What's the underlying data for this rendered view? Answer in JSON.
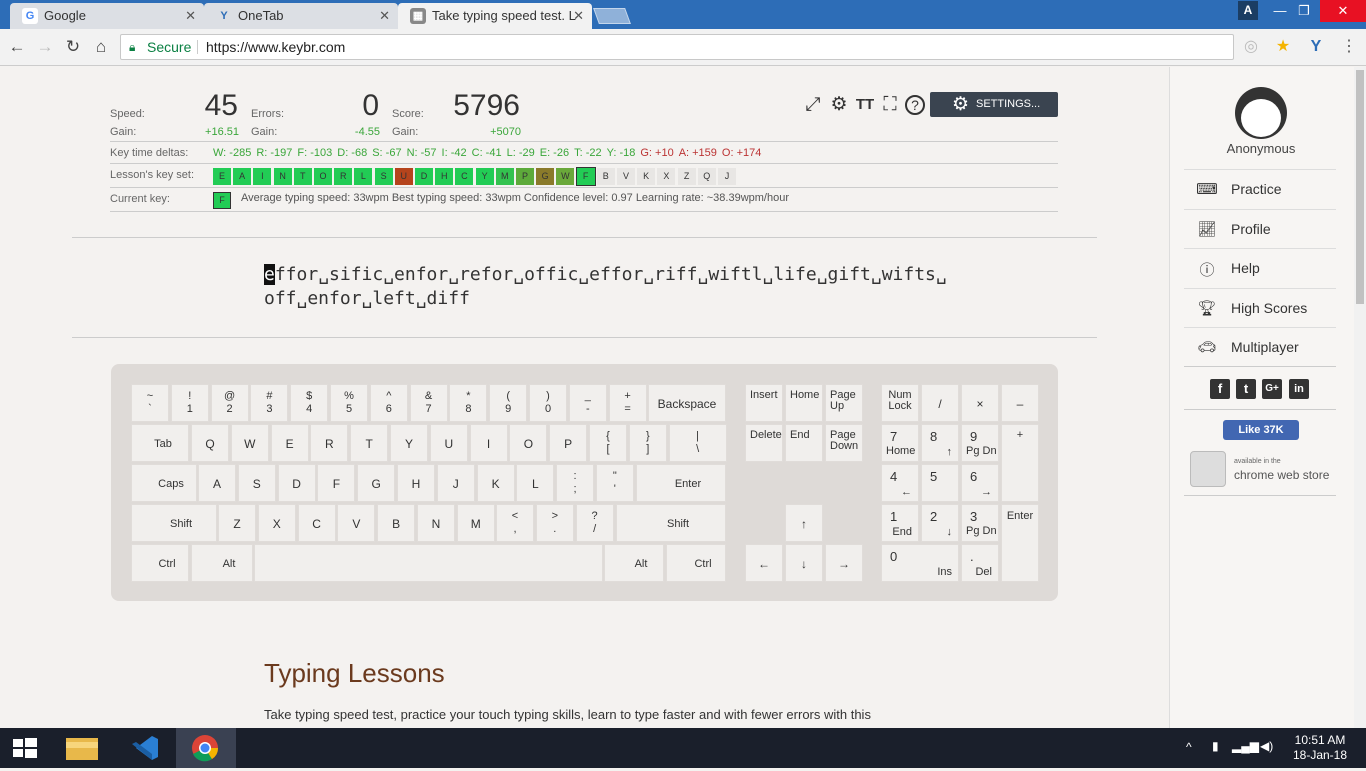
{
  "browser": {
    "tabs": [
      {
        "title": "Google",
        "icon": "google-icon",
        "active": false
      },
      {
        "title": "OneTab",
        "icon": "onetab-icon",
        "active": false
      },
      {
        "title": "Take typing speed test. L",
        "icon": "keybr-icon",
        "active": true
      }
    ],
    "profile_initial": "A",
    "secure_label": "Secure",
    "url": "https://www.keybr.com"
  },
  "stats": {
    "speed_label": "Speed:",
    "speed_value": "45",
    "speed_gain_label": "Gain:",
    "speed_gain": "+16.51",
    "errors_label": "Errors:",
    "errors_value": "0",
    "errors_gain_label": "Gain:",
    "errors_gain": "-4.55",
    "score_label": "Score:",
    "score_value": "5796",
    "score_gain_label": "Gain:",
    "score_gain": "+5070"
  },
  "key_deltas_label": "Key time deltas:",
  "key_deltas": [
    {
      "text": "W: -285",
      "sign": "pos"
    },
    {
      "text": "R: -197",
      "sign": "pos"
    },
    {
      "text": "F: -103",
      "sign": "pos"
    },
    {
      "text": "D: -68",
      "sign": "pos"
    },
    {
      "text": "S: -67",
      "sign": "pos"
    },
    {
      "text": "N: -57",
      "sign": "pos"
    },
    {
      "text": "I: -42",
      "sign": "pos"
    },
    {
      "text": "C: -41",
      "sign": "pos"
    },
    {
      "text": "L: -29",
      "sign": "pos"
    },
    {
      "text": "E: -26",
      "sign": "pos"
    },
    {
      "text": "T: -22",
      "sign": "pos"
    },
    {
      "text": "Y: -18",
      "sign": "pos"
    },
    {
      "text": "G: +10",
      "sign": "neg"
    },
    {
      "text": "A: +159",
      "sign": "neg"
    },
    {
      "text": "O: +174",
      "sign": "neg"
    }
  ],
  "keyset_label": "Lesson's key set:",
  "keyset": [
    {
      "k": "E",
      "c": "#22cc55"
    },
    {
      "k": "A",
      "c": "#22cc55"
    },
    {
      "k": "I",
      "c": "#22cc55"
    },
    {
      "k": "N",
      "c": "#22cc55"
    },
    {
      "k": "T",
      "c": "#22cc55"
    },
    {
      "k": "O",
      "c": "#22cc55"
    },
    {
      "k": "R",
      "c": "#22cc55"
    },
    {
      "k": "L",
      "c": "#22cc55"
    },
    {
      "k": "S",
      "c": "#22cc55"
    },
    {
      "k": "U",
      "c": "#b5441c"
    },
    {
      "k": "D",
      "c": "#22cc55"
    },
    {
      "k": "H",
      "c": "#22cc55"
    },
    {
      "k": "C",
      "c": "#22cc55"
    },
    {
      "k": "Y",
      "c": "#22cc55"
    },
    {
      "k": "M",
      "c": "#33c24f"
    },
    {
      "k": "P",
      "c": "#5daa3a"
    },
    {
      "k": "G",
      "c": "#8a7a2a"
    },
    {
      "k": "W",
      "c": "#6aa83a"
    },
    {
      "k": "F",
      "c": "#22cc55"
    },
    {
      "k": "B",
      "c": "#e8e6e4"
    },
    {
      "k": "V",
      "c": "#e8e6e4"
    },
    {
      "k": "K",
      "c": "#e8e6e4"
    },
    {
      "k": "X",
      "c": "#e8e6e4"
    },
    {
      "k": "Z",
      "c": "#e8e6e4"
    },
    {
      "k": "Q",
      "c": "#e8e6e4"
    },
    {
      "k": "J",
      "c": "#e8e6e4"
    }
  ],
  "current_key_label": "Current key:",
  "current_key": "F",
  "current_info": "Average typing speed: 33wpm   Best typing speed: 33wpm   Confidence level: 0.97   Learning rate: ~38.39wpm/hour",
  "settings_label": "SETTINGS...",
  "practice_cursor": "e",
  "practice_rest": "ffor␣sific␣enfor␣refor␣offic␣effor␣riff␣wiftl␣life␣gift␣wifts␣ off␣enfor␣left␣diff",
  "keyboard": {
    "row1": [
      [
        "~",
        "`"
      ],
      [
        "!",
        "1"
      ],
      [
        "@",
        "2"
      ],
      [
        "#",
        "3"
      ],
      [
        "$",
        "4"
      ],
      [
        "%",
        "5"
      ],
      [
        "^",
        "6"
      ],
      [
        "&",
        "7"
      ],
      [
        "*",
        "8"
      ],
      [
        "(",
        "9"
      ],
      [
        ")",
        "0"
      ],
      [
        "_",
        "-"
      ],
      [
        "+",
        "="
      ]
    ],
    "backspace": "Backspace",
    "tab": "Tab",
    "row2": [
      "Q",
      "W",
      "E",
      "R",
      "T",
      "Y",
      "U",
      "I",
      "O",
      "P"
    ],
    "row2sym": [
      [
        "{",
        "["
      ],
      [
        "}",
        "]"
      ],
      [
        "|",
        "\\"
      ]
    ],
    "capslock": "Caps Lock",
    "row3": [
      "A",
      "S",
      "D",
      "F",
      "G",
      "H",
      "J",
      "K",
      "L"
    ],
    "row3sym": [
      [
        ":",
        ";"
      ],
      [
        "\"",
        "'"
      ]
    ],
    "enter": "Enter",
    "shift": "Shift",
    "row4": [
      "Z",
      "X",
      "C",
      "V",
      "B",
      "N",
      "M"
    ],
    "row4sym": [
      [
        "<",
        ","
      ],
      [
        ">",
        "."
      ],
      [
        "?",
        "/"
      ]
    ],
    "ctrl": "Ctrl",
    "alt": "Alt",
    "nav": [
      "Insert",
      "Home",
      "Page Up",
      "Delete",
      "End",
      "Page Down"
    ],
    "arrows": [
      "↑",
      "←",
      "↓",
      "→"
    ],
    "numpad": {
      "numlock": "Num Lock",
      "div": "/",
      "mul": "×",
      "minus": "–",
      "plus": "+",
      "enter": "Enter",
      "n7": "7",
      "n7s": "Home",
      "n8": "8",
      "n8s": "↑",
      "n9": "9",
      "n9s": "Pg Dn",
      "n4": "4",
      "n4s": "←",
      "n5": "5",
      "n6": "6",
      "n6s": "→",
      "n1": "1",
      "n1s": "End",
      "n2": "2",
      "n2s": "↓",
      "n3": "3",
      "n3s": "Pg Dn",
      "n0": "0",
      "n0s": "Ins",
      "dot": ".",
      "dots": "Del"
    }
  },
  "lessons_title": "Typing Lessons",
  "lessons_text": "Take typing speed test, practice your touch typing skills, learn to type faster and with fewer errors with this",
  "sidebar": {
    "user": "Anonymous",
    "items": [
      {
        "label": "Practice",
        "icon": "keyboard-icon"
      },
      {
        "label": "Profile",
        "icon": "chart-icon"
      },
      {
        "label": "Help",
        "icon": "help-icon"
      },
      {
        "label": "High Scores",
        "icon": "trophy-icon"
      },
      {
        "label": "Multiplayer",
        "icon": "car-icon"
      }
    ],
    "like_label": "Like 37K",
    "cws_available": "available in the",
    "cws_name": "chrome web store"
  },
  "taskbar": {
    "time": "10:51 AM",
    "date": "18-Jan-18"
  }
}
